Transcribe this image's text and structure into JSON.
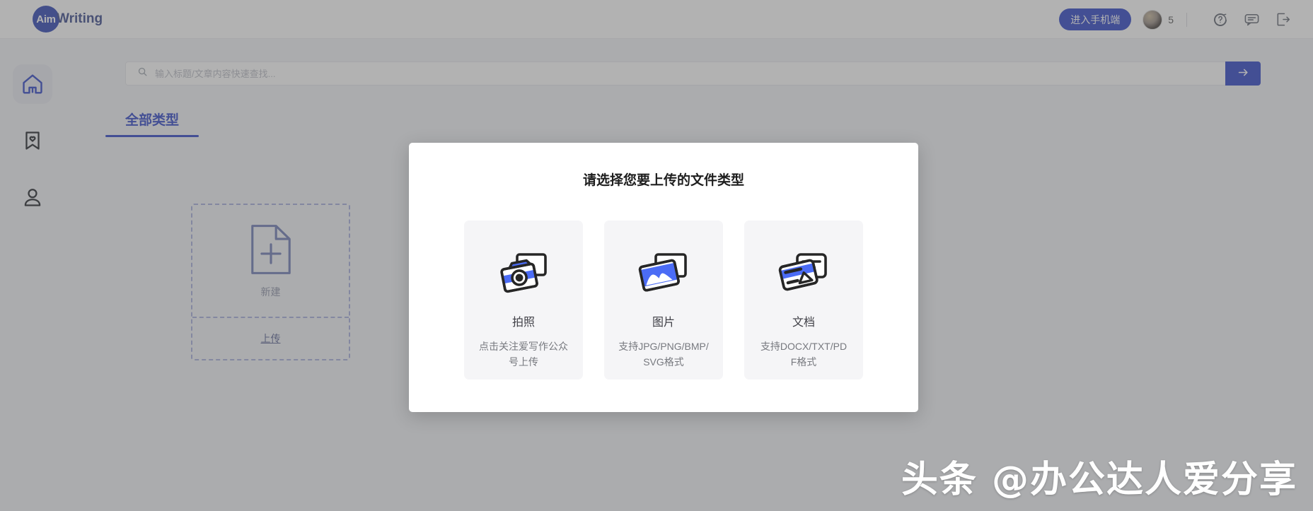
{
  "header": {
    "logo_badge": "Aim",
    "logo_text": "Writing",
    "mobile_button": "进入手机端",
    "coin_count": "5",
    "icons": {
      "help": "help-circle-icon",
      "message": "message-icon",
      "logout": "logout-icon",
      "avatar": "user-avatar"
    }
  },
  "sidebar": {
    "items": [
      {
        "name": "home",
        "icon": "home-icon",
        "active": true
      },
      {
        "name": "favorites",
        "icon": "bookmark-heart-icon",
        "active": false
      },
      {
        "name": "profile",
        "icon": "user-icon",
        "active": false
      }
    ]
  },
  "search": {
    "placeholder": "输入标题/文章内容快速查找...",
    "value": "",
    "icon": "search-icon",
    "submit_icon": "arrow-right-icon"
  },
  "tabs": [
    {
      "label": "全部类型",
      "active": true
    }
  ],
  "upload_card": {
    "new_label": "新建",
    "new_icon": "file-plus-icon",
    "upload_label": "上传"
  },
  "modal": {
    "title": "请选择您要上传的文件类型",
    "options": [
      {
        "name": "拍照",
        "desc": "点击关注爱写作公众号上传",
        "icon": "camera-photo-icon"
      },
      {
        "name": "图片",
        "desc": "支持JPG/PNG/BMP/SVG格式",
        "icon": "image-picture-icon"
      },
      {
        "name": "文档",
        "desc": "支持DOCX/TXT/PDF格式",
        "icon": "document-card-icon"
      }
    ]
  },
  "watermark": {
    "text": "头条 @办公达人爱分享"
  },
  "colors": {
    "accent": "#2f45c6",
    "page_bg": "#f2f3f7",
    "card_bg": "#f5f5f7",
    "icon_blue": "#4b6cf5",
    "icon_dark": "#262626"
  }
}
